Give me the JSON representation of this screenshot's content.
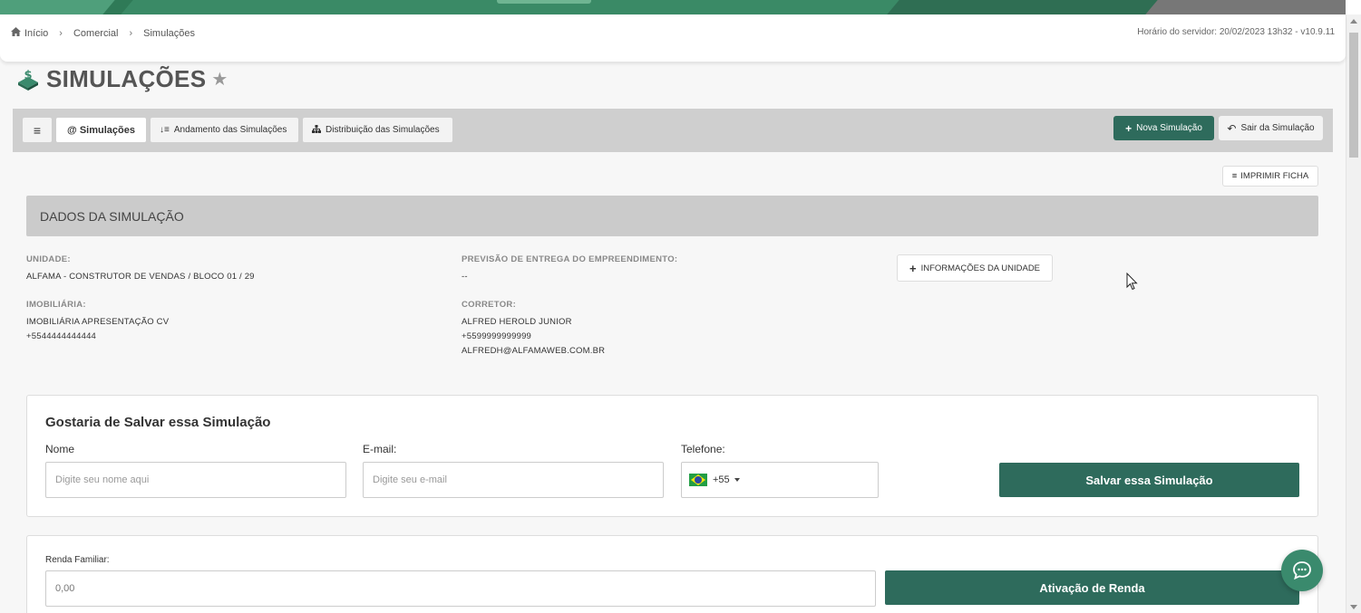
{
  "breadcrumb": {
    "home": "Início",
    "level2": "Comercial",
    "level3": "Simulações"
  },
  "server_time": "Horário do servidor: 20/02/2023 13h32 - v10.9.11",
  "page": {
    "title": "SIMULAÇÕES"
  },
  "tabs": {
    "menu_icon": "≡",
    "simulacoes": "@ Simulações",
    "andamento": "Andamento das Simulações",
    "distribuicao": "Distribuição das Simulações",
    "nova": "Nova Simulação",
    "sair": "Sair da Simulação"
  },
  "print_button": "IMPRIMIR FICHA",
  "section_title": "DADOS DA SIMULAÇÃO",
  "details": {
    "unidade_label": "UNIDADE:",
    "unidade_value": "ALFAMA - CONSTRUTOR DE VENDAS / BLOCO 01 / 29",
    "previsao_label": "PREVISÃO DE ENTREGA DO EMPREENDIMENTO:",
    "previsao_value": "--",
    "info_button": "INFORMAÇÕES DA UNIDADE",
    "imobiliaria_label": "IMOBILIÁRIA:",
    "imobiliaria_name": "IMOBILIÁRIA APRESENTAÇÃO CV",
    "imobiliaria_phone": "+5544444444444",
    "corretor_label": "CORRETOR:",
    "corretor_name": "ALFRED HEROLD JUNIOR",
    "corretor_phone": "+5599999999999",
    "corretor_email": "ALFREDH@ALFAMAWEB.COM.BR"
  },
  "save_form": {
    "title": "Gostaria de Salvar essa Simulação",
    "nome_label": "Nome",
    "nome_placeholder": "Digite seu nome aqui",
    "email_label": "E-mail:",
    "email_placeholder": "Digite seu e-mail",
    "telefone_label": "Telefone:",
    "phone_code": "+55",
    "submit": "Salvar essa Simulação"
  },
  "renda": {
    "label": "Renda Familiar:",
    "value": "0,00",
    "button": "Ativação de Renda"
  },
  "colors": {
    "brand_green": "#2e6b5c",
    "top_bar": "#3a8a66"
  }
}
